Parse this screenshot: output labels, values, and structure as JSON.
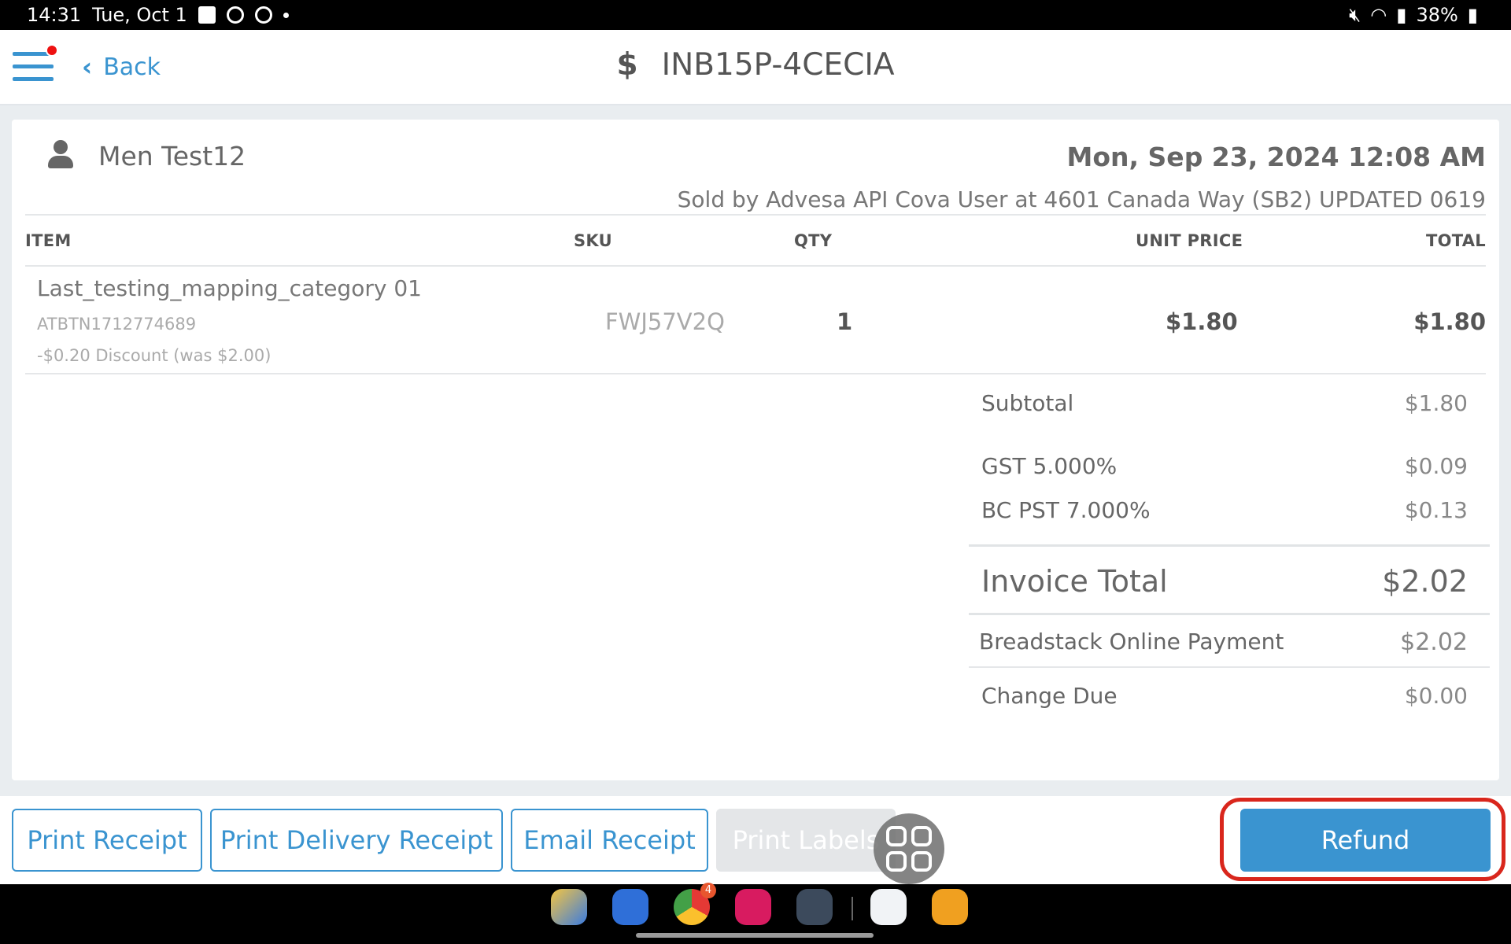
{
  "status_bar": {
    "time": "14:31",
    "date": "Tue, Oct 1",
    "battery": "38%",
    "left_icons": [
      "gallery-icon",
      "chrome-icon",
      "chrome-icon",
      "dot-icon"
    ],
    "right_icons": [
      "mute-icon",
      "wifi-icon",
      "signal-icon",
      "battery-icon"
    ]
  },
  "header": {
    "back_label": "Back",
    "title_symbol": "$",
    "title": "INB15P-4CECIA"
  },
  "customer": {
    "name": "Men Test12"
  },
  "sale": {
    "date": "Mon, Sep 23, 2024 12:08 AM",
    "sold_by": "Sold by Advesa API Cova User at 4601 Canada Way (SB2) UPDATED 0619"
  },
  "table": {
    "columns": [
      "ITEM",
      "SKU",
      "QTY",
      "UNIT PRICE",
      "TOTAL"
    ],
    "rows": [
      {
        "name": "Last_testing_mapping_category 01",
        "code": "ATBTN1712774689",
        "discount": "-$0.20 Discount (was $2.00)",
        "sku": "FWJ57V2Q",
        "qty": "1",
        "unit_price": "$1.80",
        "total": "$1.80"
      }
    ]
  },
  "summary": {
    "subtotal_label": "Subtotal",
    "subtotal_value": "$1.80",
    "gst_label": "GST  5.000%",
    "gst_value": "$0.09",
    "pst_label": "BC PST  7.000%",
    "pst_value": "$0.13",
    "invoice_total_label": "Invoice Total",
    "invoice_total_value": "$2.02",
    "payment_label": "Breadstack Online Payment",
    "payment_value": "$2.02",
    "change_label": "Change Due",
    "change_value": "$0.00"
  },
  "actions": {
    "print_receipt": "Print Receipt",
    "print_delivery_receipt": "Print Delivery Receipt",
    "email_receipt": "Email Receipt",
    "print_labels": "Print Labels",
    "refund": "Refund"
  },
  "dock": {
    "apps": [
      "files-app-icon",
      "messages-app-icon",
      "chrome-app-icon",
      "camera-app-icon",
      "app-drawer-icon",
      "breadstack-app-icon",
      "delivery-app-icon"
    ],
    "chrome_badge": "4"
  },
  "colors": {
    "accent": "#3a94d0",
    "highlight_ring": "#d9261c",
    "notification_dot": "#ee1111"
  }
}
